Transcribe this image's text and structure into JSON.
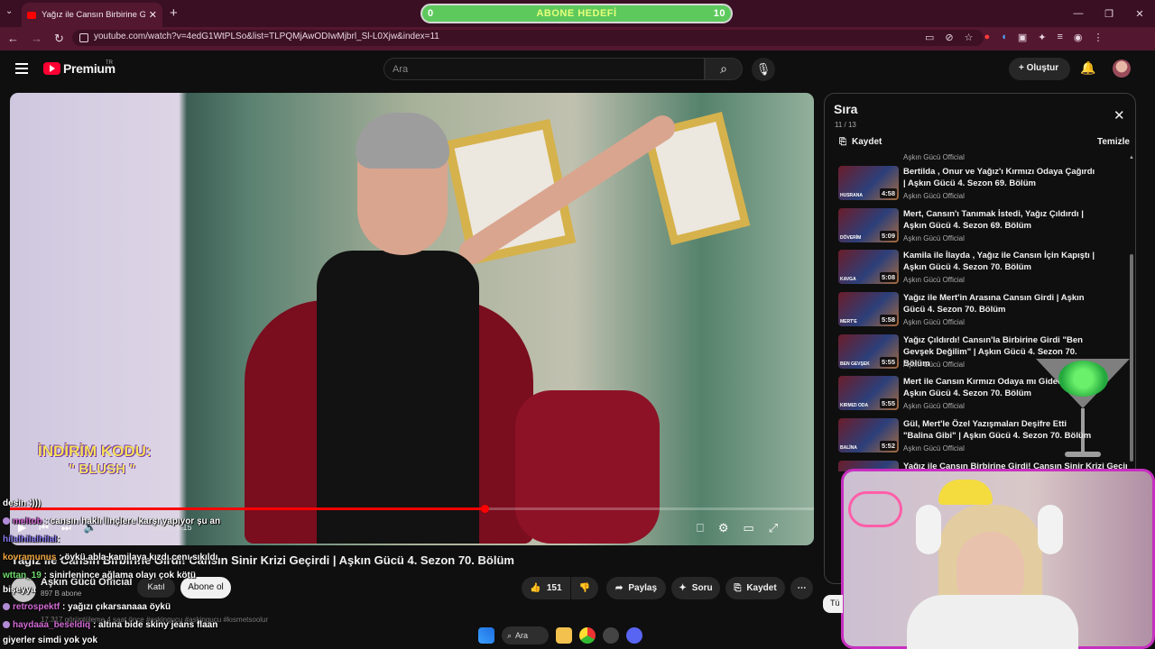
{
  "browser": {
    "tab_title": "Yağız ile Cansın Birbirine Girdi! C",
    "url": "youtube.com/watch?v=4edG1WtPLSo&list=TLPQMjAwODIwMjbrl_Sl-L0Xjw&index=11",
    "goal_left": "0",
    "goal_label": "ABONE HEDEFİ",
    "goal_right": "10"
  },
  "youtube": {
    "brand": "Premium",
    "brand_badge": "TR",
    "search_placeholder": "Ara",
    "create_label": "Oluştur"
  },
  "video": {
    "promo_line1": "İNDİRİM KODU:",
    "promo_line2": "\" BLUSH \"",
    "timecode": "3:05 / 5:15",
    "progress_fraction": 0.59,
    "title": "Yağız ile Cansın Birbirine Girdi! Cansın Sinir Krizi Geçirdi | Aşkın Gücü 4. Sezon 70. Bölüm",
    "channel": "Aşkın Gücü Official",
    "subscribers": "897 B abone",
    "join_label": "Katıl",
    "subscribe_label": "Abone ol",
    "likes": "151",
    "share_label": "Paylaş",
    "ask_label": "Soru",
    "save_label": "Kaydet",
    "views": "17.317 görüntüleme  4 saat önce  #askingucu #askingucu #kısmetsoolur"
  },
  "playlist": {
    "title": "Sıra",
    "count": "11 / 13",
    "save_label": "Kaydet",
    "clear_label": "Temizle",
    "prev_channel": "Aşkın Gücü Official",
    "items": [
      {
        "title": "Bertilda , Onur ve Yağız'ı Kırmızı Odaya Çağırdı | Aşkın Gücü 4. Sezon 69. Bölüm",
        "channel": "Aşkın Gücü Official",
        "duration": "4:58",
        "tag": "HUSRANA"
      },
      {
        "title": "Mert, Cansın'ı Tanımak İstedi, Yağız Çıldırdı | Aşkın Gücü 4. Sezon 69. Bölüm",
        "channel": "Aşkın Gücü Official",
        "duration": "5:09",
        "tag": "DÖVERİM"
      },
      {
        "title": "Kamila ile İlayda , Yağız ile Cansın İçin Kapıştı | Aşkın Gücü 4. Sezon 70. Bölüm",
        "channel": "Aşkın Gücü Official",
        "duration": "5:08",
        "tag": "KAVGA"
      },
      {
        "title": "Yağız ile Mert'in Arasına Cansın Girdi | Aşkın Gücü 4. Sezon 70. Bölüm",
        "channel": "Aşkın Gücü Official",
        "duration": "5:58",
        "tag": "MERT'E"
      },
      {
        "title": "Yağız Çıldırdı! Cansın'la Birbirine Girdi \"Ben Gevşek Değilim\" | Aşkın Gücü 4. Sezon 70. Bölüm",
        "channel": "Aşkın Gücü Official",
        "duration": "5:55",
        "tag": "BEN GEVŞEK"
      },
      {
        "title": "Mert ile Cansın Kırmızı Odaya mı Gidecek? | Aşkın Gücü 4. Sezon 70. Bölüm",
        "channel": "Aşkın Gücü Official",
        "duration": "5:55",
        "tag": "KIRMIZI ODA"
      },
      {
        "title": "Gül, Mert'le Özel Yazışmaları Deşifre Etti \"Balina Gibi\" | Aşkın Gücü 4. Sezon 70. Bölüm",
        "channel": "Aşkın Gücü Official",
        "duration": "5:52",
        "tag": "BALİNA"
      },
      {
        "title": "Yağız ile Cansın Birbirine Girdi! Cansın Sinir Krizi Geçirdi",
        "channel": "",
        "duration": "",
        "tag": ""
      }
    ],
    "next_button": "Tü"
  },
  "chat": [
    {
      "user": "",
      "text": "desin :)))"
    },
    {
      "user": "meltob",
      "text": ": cansın haklı linçlere karşı yapıyor şu an"
    },
    {
      "user": "hilalhilalhilal",
      "text": ":"
    },
    {
      "user": "kovramunus",
      "text": ": öykü abla kamilaya kızdı cenı sıkıldı"
    },
    {
      "user": "wttan_19",
      "text": ": sinirlenince ağlama olayı çok kötü"
    },
    {
      "user": "",
      "text": "bişeyya"
    },
    {
      "user": "retrospektf",
      "text": ": yağızı çıkarsanaaa öykü"
    },
    {
      "user": "haydaaa_beseldiq",
      "text": ": altına bide skiny jeans flaan"
    },
    {
      "user": "",
      "text": "giyerler simdi yok yok"
    }
  ],
  "taskbar": {
    "search_label": "Ara"
  },
  "colors": {
    "accent": "#ff0000",
    "browser_frame": "#53172f",
    "webcam_border": "#c62fbf",
    "goal_bar": "#5dc95d"
  }
}
